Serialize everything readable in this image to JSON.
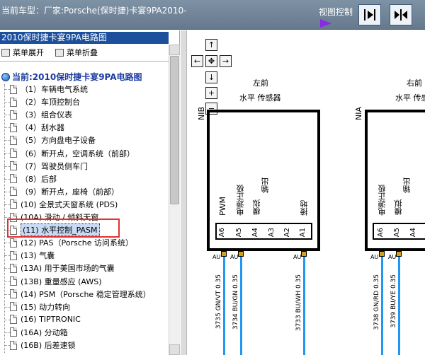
{
  "titlebar": {
    "car_model": "当前车型：厂家:Porsche(保时捷)卡宴9PA2010-",
    "view_control": "视图控制",
    "colors": {
      "bar": "#74889c",
      "arrow": "#8a2be2"
    }
  },
  "leftpanel": {
    "header": "2010保时捷卡宴9PA电路图",
    "menu_expand": "菜单展开",
    "menu_collapse": "菜单折叠",
    "root": "当前:2010保时捷卡宴9PA电路图",
    "items": [
      {
        "label": "（1）车辆电气系统"
      },
      {
        "label": "（2）车顶控制台"
      },
      {
        "label": "（3）组合仪表"
      },
      {
        "label": "（4）刮水器"
      },
      {
        "label": "（5）方向盘电子设备"
      },
      {
        "label": "（6）断开点，空调系统（前部）"
      },
      {
        "label": "（7）驾驶员侧车门"
      },
      {
        "label": "（8）后部"
      },
      {
        "label": "（9）断开点，座椅（前部）"
      },
      {
        "label": "(10) 全景式天窗系统 (PDS)"
      },
      {
        "label": "(10A) 滑动 / 倾斜天窗"
      },
      {
        "label": "(11) 水平控制_PASM",
        "selected": true
      },
      {
        "label": "(12) PAS（Porsche 访问系统）"
      },
      {
        "label": "(13) 气囊"
      },
      {
        "label": "(13A) 用于美国市场的气囊"
      },
      {
        "label": "(13B) 重量感应 (AWS)"
      },
      {
        "label": "(14) PSM（Porsche 稳定管理系统）"
      },
      {
        "label": "(15) 动力转向"
      },
      {
        "label": "(16) TIPTRONIC"
      },
      {
        "label": "(16A) 分动箱"
      },
      {
        "label": "(16B) 后差速锁"
      }
    ]
  },
  "diagram": {
    "left": {
      "title": "左前",
      "subtitle": "水平 传感器",
      "side_code": "NIB",
      "pins": [
        "PWM",
        "电源正极",
        "模拟",
        "输出",
        "接地"
      ],
      "pin_numbers": [
        "A6",
        "A5",
        "A4",
        "A3",
        "A2",
        "A1"
      ],
      "wires": [
        "3735 GN/VT 0.35",
        "3734 BU/GN 0.35",
        "3733 BU/WH 0.35"
      ]
    },
    "right": {
      "title": "右前",
      "subtitle": "水平 传感器",
      "side_code": "NIA",
      "pins": [
        "电源正极",
        "模拟",
        "输出"
      ],
      "pin_numbers": [
        "A6",
        "A5",
        "A4"
      ],
      "wires": [
        "3738 GN/RD 0.35",
        "3739 BU/YE 0.35"
      ]
    },
    "au_label": "AU"
  }
}
